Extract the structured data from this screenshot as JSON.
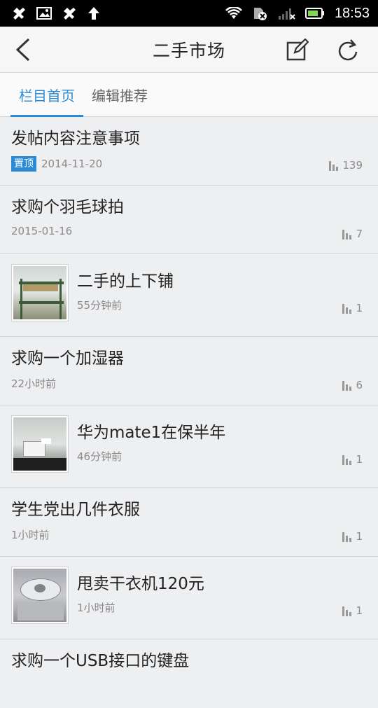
{
  "status": {
    "time": "18:53"
  },
  "header": {
    "title": "二手市场"
  },
  "tabs": [
    {
      "label": "栏目首页",
      "active": true
    },
    {
      "label": "编辑推荐",
      "active": false
    }
  ],
  "posts": [
    {
      "title": "发帖内容注意事项",
      "badge": "置顶",
      "time": "2014-11-20",
      "views": "139",
      "thumb": null
    },
    {
      "title": "求购个羽毛球拍",
      "time": "2015-01-16",
      "views": "7",
      "thumb": null
    },
    {
      "title": "二手的上下铺",
      "time": "55分钟前",
      "views": "1",
      "thumb": "bunk-bed-photo"
    },
    {
      "title": "求购一个加湿器",
      "time": "22小时前",
      "views": "6",
      "thumb": null
    },
    {
      "title": "华为mate1在保半年",
      "time": "46分钟前",
      "views": "1",
      "thumb": "phone-box-photo"
    },
    {
      "title": "学生党出几件衣服",
      "time": "1小时前",
      "views": "1",
      "thumb": null
    },
    {
      "title": "甩卖干衣机120元",
      "time": "1小时前",
      "views": "1",
      "thumb": "dryer-photo"
    },
    {
      "title": "求购一个USB接口的键盘",
      "time": "",
      "views": "",
      "thumb": null
    }
  ],
  "colors": {
    "accent": "#2a8ad6",
    "background": "#eeeff1"
  }
}
